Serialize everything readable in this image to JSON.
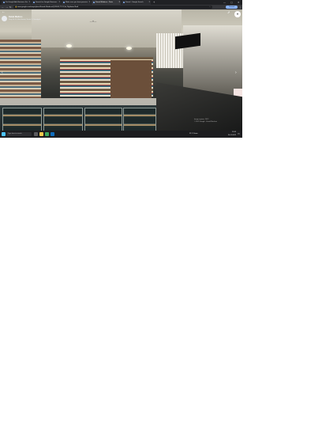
{
  "browser": {
    "tabs": [
      {
        "label": "Fix Google Ads Business Suspen",
        "active": false
      },
      {
        "label": "Search for Google Business Pr",
        "active": false
      },
      {
        "label": "Make sure you have permission",
        "active": false
      },
      {
        "label": "Kamal Medicos - Parts",
        "active": true
      },
      {
        "label": "Kamal - Google Search",
        "active": false
      }
    ],
    "new_tab": "+",
    "window_controls": {
      "minimize": "—",
      "maximize": "▢",
      "close": "✕"
    },
    "url": "www.google.com/maps/place/Kamal+Medicos/@28.69,77.21,3a,75y/data=!3m6",
    "profile_label": "Paused"
  },
  "streetview": {
    "place_name": "Kamal Medicos",
    "place_address": "Shop No 14, Main Bazaar, Sector 5, Chandigarh",
    "watermark_line1": "Image capture: 2022",
    "watermark_line2": "© 2022 Google · Kamal Medicos"
  },
  "taskbar": {
    "search_placeholder": "Type here to search",
    "weather": "31°C Haze",
    "time": "13:45",
    "date": "20-11-2022"
  },
  "colors": {
    "chrome_dark": "#202124",
    "chrome_toolbar": "#35363a",
    "accent": "#8ab4f8",
    "taskbar": "#1c1c1f"
  }
}
